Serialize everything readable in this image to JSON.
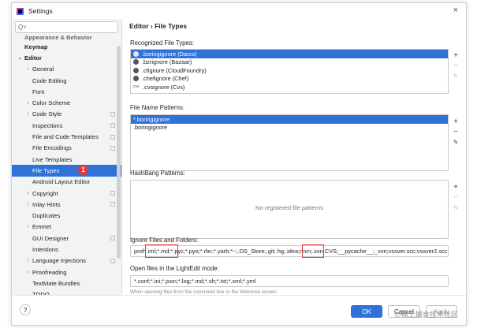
{
  "window": {
    "title": "Settings",
    "close_glyph": "×"
  },
  "search": {
    "glyph": "Q˅",
    "placeholder": ""
  },
  "sidebar": {
    "items": [
      {
        "label": "Appearance & Behavior",
        "level": 0,
        "chevron": "",
        "bold": true,
        "partial": true
      },
      {
        "label": "Keymap",
        "level": 0,
        "chevron": "",
        "bold": true
      },
      {
        "label": "Editor",
        "level": 0,
        "chevron": "⌄",
        "bold": true
      },
      {
        "label": "General",
        "level": 1,
        "chevron": "›"
      },
      {
        "label": "Code Editing",
        "level": 1,
        "chevron": ""
      },
      {
        "label": "Font",
        "level": 1,
        "chevron": ""
      },
      {
        "label": "Color Scheme",
        "level": 1,
        "chevron": "›"
      },
      {
        "label": "Code Style",
        "level": 1,
        "chevron": "›",
        "cfg": true
      },
      {
        "label": "Inspections",
        "level": 1,
        "chevron": "",
        "cfg": true
      },
      {
        "label": "File and Code Templates",
        "level": 1,
        "chevron": "",
        "cfg": true
      },
      {
        "label": "File Encodings",
        "level": 1,
        "chevron": "",
        "cfg": true
      },
      {
        "label": "Live Templates",
        "level": 1,
        "chevron": ""
      },
      {
        "label": "File Types",
        "level": 1,
        "chevron": "",
        "selected": true
      },
      {
        "label": "Android Layout Editor",
        "level": 1,
        "chevron": ""
      },
      {
        "label": "Copyright",
        "level": 1,
        "chevron": "›",
        "cfg": true
      },
      {
        "label": "Inlay Hints",
        "level": 1,
        "chevron": "›",
        "cfg": true
      },
      {
        "label": "Duplicates",
        "level": 1,
        "chevron": ""
      },
      {
        "label": "Emmet",
        "level": 1,
        "chevron": "›"
      },
      {
        "label": "GUI Designer",
        "level": 1,
        "chevron": "",
        "cfg": true
      },
      {
        "label": "Intentions",
        "level": 1,
        "chevron": ""
      },
      {
        "label": "Language Injections",
        "level": 1,
        "chevron": "›",
        "cfg": true
      },
      {
        "label": "Proofreading",
        "level": 1,
        "chevron": "›"
      },
      {
        "label": "TextMate Bundles",
        "level": 1,
        "chevron": ""
      },
      {
        "label": "TODO",
        "level": 1,
        "chevron": ""
      }
    ],
    "badge": "1"
  },
  "main": {
    "breadcrumb": "Editor  ›  File Types",
    "recognized": {
      "label": "Recognized File Types:",
      "items": [
        {
          "icon": "darcs-icon",
          "icon_text": "",
          "text": ".boringignore (Darcs)",
          "selected": true
        },
        {
          "icon": "bazaar-icon",
          "icon_text": "",
          "text": ".bzrignore (Bazaar)"
        },
        {
          "icon": "cloudfoundry-icon",
          "icon_text": "",
          "text": ".cfignore (CloudFoundry)"
        },
        {
          "icon": "chef-icon",
          "icon_text": "",
          "text": ".chefignore (Chef)"
        },
        {
          "icon": "cvs-icon",
          "icon_text": "cvs",
          "text": ".cvsignore (Cvs)"
        }
      ]
    },
    "patterns": {
      "label": "File Name Patterns:",
      "items": [
        {
          "text": "*.boringignore",
          "selected": true
        },
        {
          "text": ".boringignore"
        }
      ]
    },
    "hashbang": {
      "label": "HashBang Patterns:",
      "empty_text": "No registered file patterns"
    },
    "ignore": {
      "label": "Ignore Files and Folders:",
      "value": "prof*.iml;*.md;*.pyc;*.pyo;*.rbc;*.yarb;*~;.DS_Store;.git;.hg;.idea;mvn;.svn;CVS;__pycache__;_svn;vssver.scc;vssver2.scc;"
    },
    "lightedit": {
      "label": "Open files in the LightEdit mode:",
      "value": "*.conf;*.ini;*.json;*.log;*.md;*.sh;*.txt;*.xml;*.yml",
      "hint": "When opening files from the command line or the Welcome screen"
    },
    "tools": {
      "add": "+",
      "remove": "−",
      "edit": "✎"
    }
  },
  "footer": {
    "help": "?",
    "ok": "OK",
    "cancel": "Cancel",
    "apply": "Apply"
  },
  "watermark": "@稀土掘金技术社区",
  "colors": {
    "accent": "#2f72d8",
    "highlight": "#e53935",
    "badge": "#e63b3b"
  }
}
